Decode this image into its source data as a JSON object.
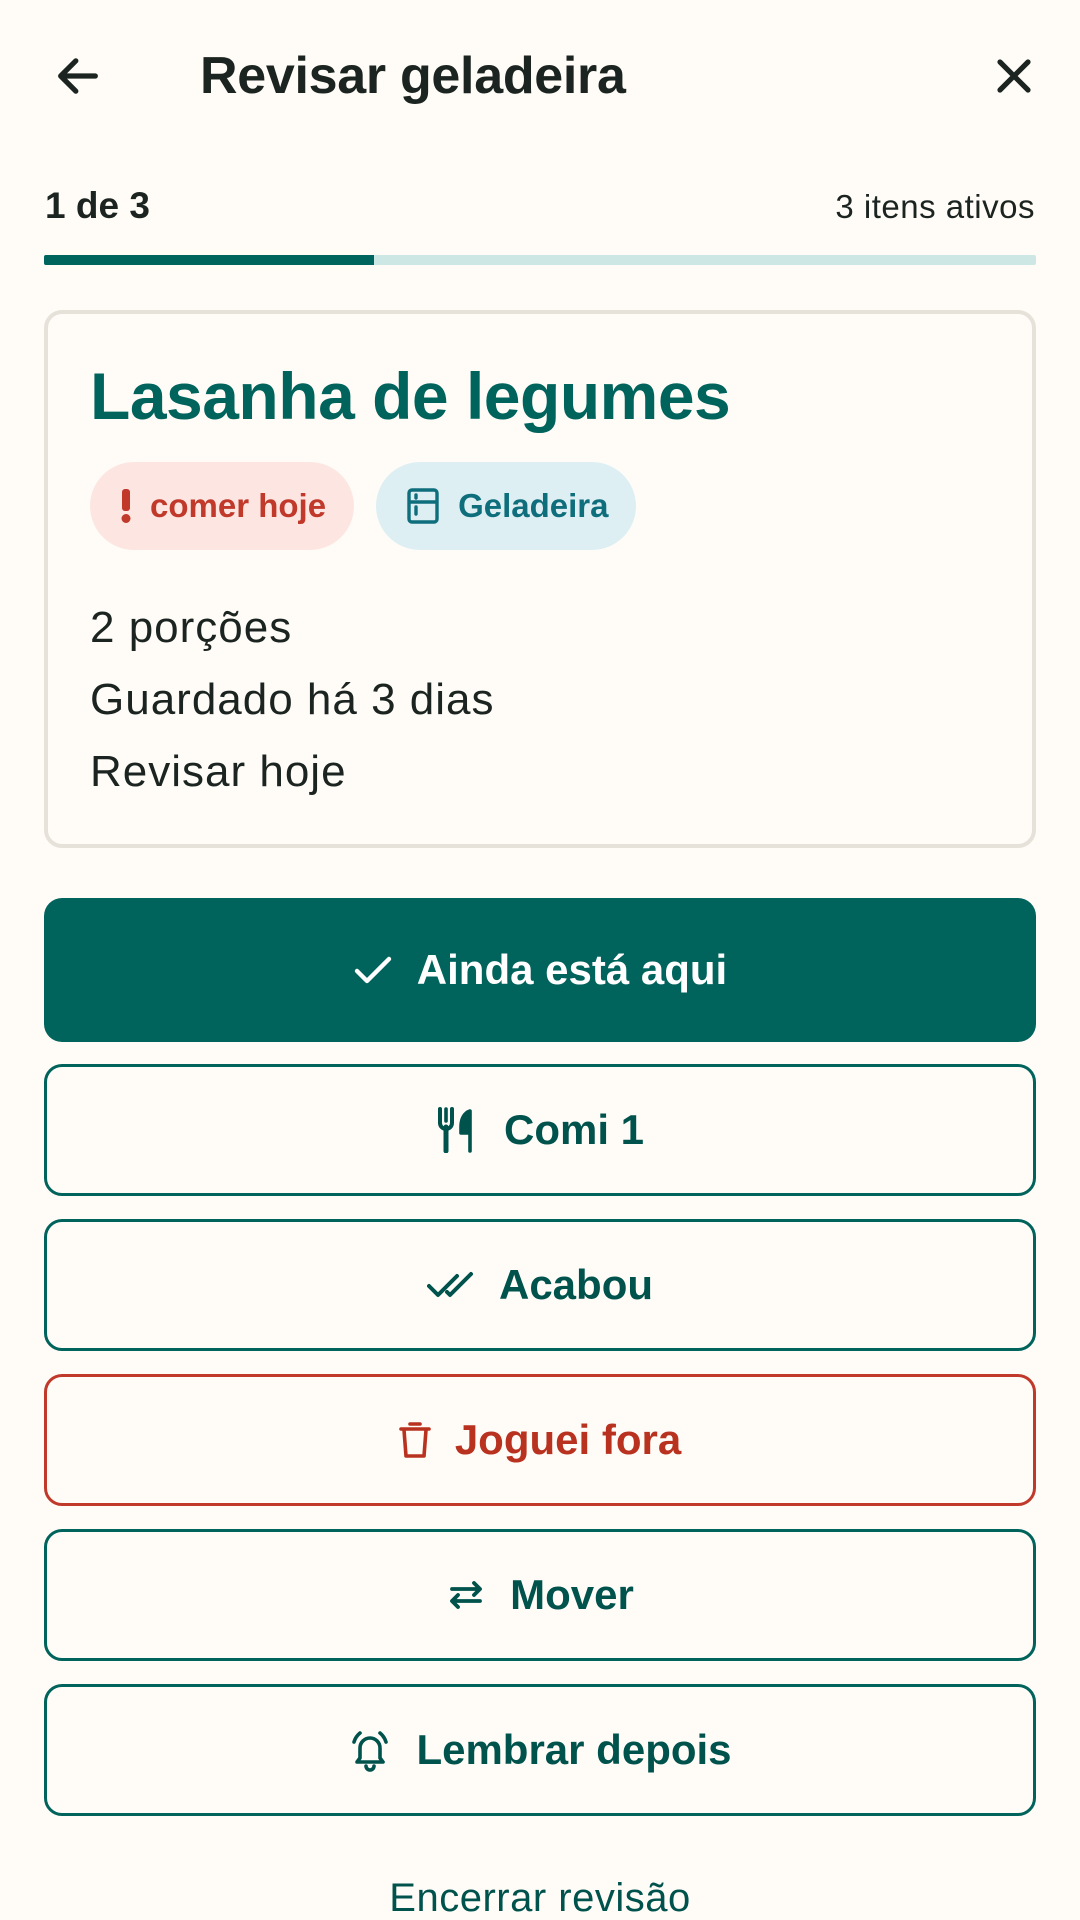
{
  "header": {
    "title": "Revisar geladeira",
    "back_icon": "arrow-left-icon",
    "close_icon": "close-icon"
  },
  "progress": {
    "step_label": "1 de 3",
    "active_items_label": "3 itens ativos",
    "current": 1,
    "total": 3,
    "fraction": 0.333,
    "track_color": "#CDE8E4",
    "fill_color": "#00645E"
  },
  "item_card": {
    "name": "Lasanha de legumes",
    "urgency_chip": {
      "label": "comer hoje",
      "icon": "exclamation-icon",
      "bg": "#FDE6E1",
      "color": "#C0392B"
    },
    "location_chip": {
      "label": "Geladeira",
      "icon": "fridge-icon",
      "bg": "#DDEFF3",
      "color": "#0F6E7C"
    },
    "portions": "2 porções",
    "stored": "Guardado há 3 dias",
    "review": "Revisar hoje"
  },
  "actions": {
    "still_here": {
      "label": "Ainda está aqui",
      "icon": "check-icon"
    },
    "ate_one": {
      "label": "Comi 1",
      "icon": "fork-knife-icon"
    },
    "finished": {
      "label": "Acabou",
      "icon": "double-check-icon"
    },
    "discarded": {
      "label": "Joguei fora",
      "icon": "trash-icon"
    },
    "move": {
      "label": "Mover",
      "icon": "swap-arrows-icon"
    },
    "remind_later": {
      "label": "Lembrar depois",
      "icon": "alarm-bell-icon"
    }
  },
  "footer": {
    "end_review": "Encerrar revisão"
  },
  "colors": {
    "brand": "#00635C",
    "danger": "#C0392B",
    "background": "#FFFCF7"
  }
}
